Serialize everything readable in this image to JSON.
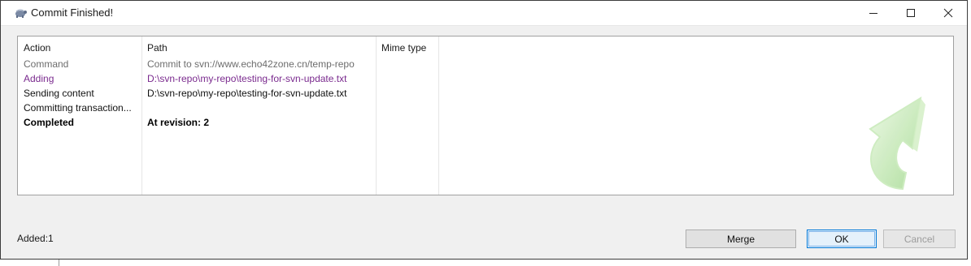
{
  "window": {
    "title": "Commit Finished!"
  },
  "list": {
    "columns": [
      "Action",
      "Path",
      "Mime type"
    ],
    "rows": [
      {
        "action": "Command",
        "path": "Commit to svn://www.echo42zone.cn/temp-repo",
        "style": "grey"
      },
      {
        "action": "Adding",
        "path": "D:\\svn-repo\\my-repo\\testing-for-svn-update.txt",
        "style": "purple"
      },
      {
        "action": "Sending content",
        "path": "D:\\svn-repo\\my-repo\\testing-for-svn-update.txt",
        "style": "black"
      },
      {
        "action": "Committing transaction...",
        "path": "",
        "style": "black"
      },
      {
        "action": "Completed",
        "path": "At revision: 2",
        "style": "bold"
      }
    ]
  },
  "status": "Added:1",
  "buttons": {
    "merge": "Merge",
    "ok": "OK",
    "cancel": "Cancel"
  },
  "colors": {
    "grey_text": "#6d6d6d",
    "purple_text": "#7a2a8e",
    "ok_border": "#0078d7",
    "arrow_green": "#b9e8a8"
  },
  "icons": [
    "tortoise-app-icon",
    "minimize-icon",
    "maximize-icon",
    "close-icon",
    "commit-arrow-graphic"
  ]
}
